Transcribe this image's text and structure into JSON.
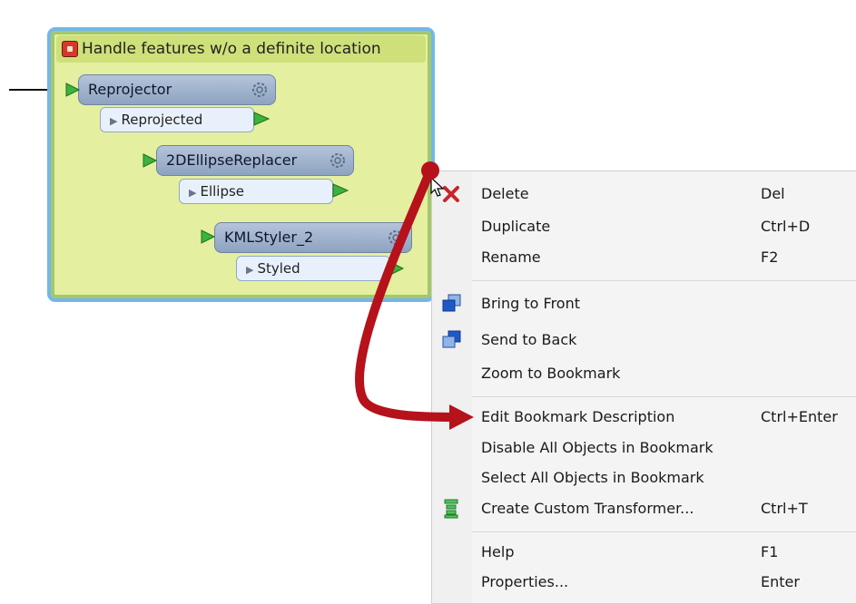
{
  "bookmark": {
    "title": "Handle features w/o a definite location"
  },
  "transformers": [
    {
      "name": "Reprojector",
      "port": "Reprojected"
    },
    {
      "name": "2DEllipseReplacer",
      "port": "Ellipse"
    },
    {
      "name": "KMLStyler_2",
      "port": "Styled"
    }
  ],
  "menu": {
    "items": [
      {
        "label": "Delete",
        "shortcut": "Del",
        "icon": "delete-x-icon"
      },
      {
        "label": "Duplicate",
        "shortcut": "Ctrl+D"
      },
      {
        "label": "Rename",
        "shortcut": "F2"
      },
      {
        "label": "Bring to Front",
        "shortcut": "",
        "icon": "bring-to-front-icon"
      },
      {
        "label": "Send to Back",
        "shortcut": "",
        "icon": "send-to-back-icon"
      },
      {
        "label": "Zoom to Bookmark",
        "shortcut": ""
      },
      {
        "label": "Edit Bookmark Description",
        "shortcut": "Ctrl+Enter"
      },
      {
        "label": "Disable All Objects in Bookmark",
        "shortcut": ""
      },
      {
        "label": "Select All Objects in Bookmark",
        "shortcut": ""
      },
      {
        "label": "Create Custom Transformer...",
        "shortcut": "Ctrl+T",
        "icon": "custom-transformer-icon"
      },
      {
        "label": "Help",
        "shortcut": "F1"
      },
      {
        "label": "Properties...",
        "shortcut": "Enter"
      }
    ]
  },
  "colors": {
    "bookmark_fill": "#e4efa0",
    "bookmark_border": "#73b7ea",
    "annotation_arrow": "#b5121b",
    "transformer_fill": "#9fb2ce"
  }
}
